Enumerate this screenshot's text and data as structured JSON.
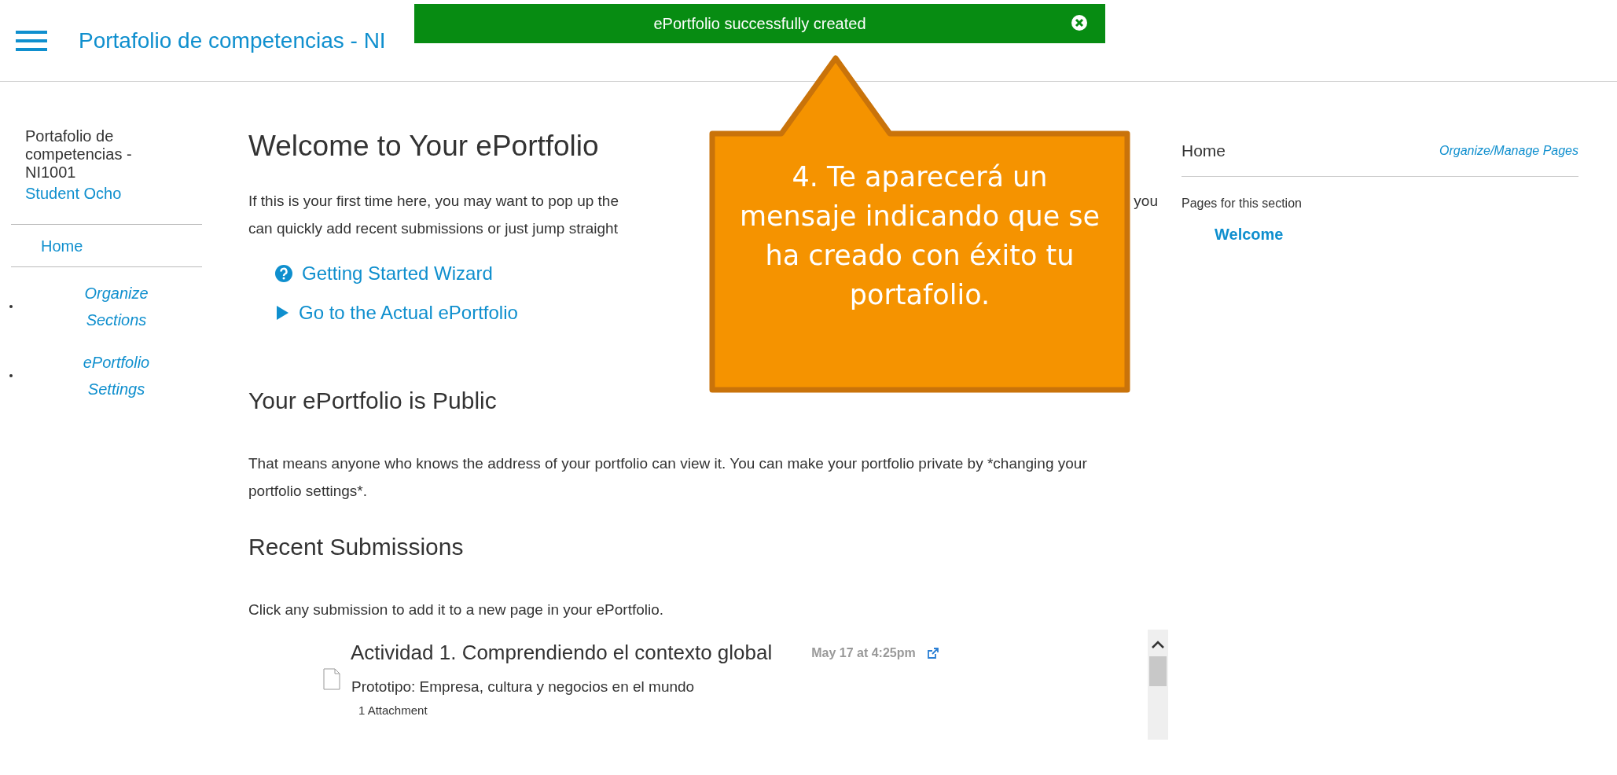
{
  "header": {
    "breadcrumb": "Portafolio de competencias - NI"
  },
  "toast": {
    "message": "ePortfolio successfully created"
  },
  "callout": {
    "text": "4. Te aparecerá un mensaje indicando que se ha creado con éxito tu portafolio."
  },
  "left_sidebar": {
    "portfolio_name": "Portafolio de competencias - NI1001",
    "user": "Student Ocho",
    "home": "Home",
    "items": [
      "Organize Sections",
      "ePortfolio Settings"
    ]
  },
  "main": {
    "title": "Welcome to Your ePortfolio",
    "intro_lines": [
      {
        "left": "If this is your first time here, you may want to pop up the",
        "right": "you"
      },
      {
        "left": "can quickly add recent submissions or just jump straight"
      }
    ],
    "links": [
      {
        "kind": "help",
        "label": "Getting Started Wizard"
      },
      {
        "kind": "go",
        "label": "Go to the Actual ePortfolio"
      }
    ],
    "public_heading": "Your ePortfolio is Public",
    "public_text": "That means anyone who knows the address of your portfolio can view it. You can make your portfolio private by *changing your portfolio settings*.",
    "recent_heading": "Recent Submissions",
    "recent_text": "Click any submission to add it to a new page in your ePortfolio.",
    "submissions": [
      {
        "title": "Actividad 1. Comprendiendo el contexto global",
        "date": "May 17 at 4:25pm",
        "subtitle": "Prototipo: Empresa, cultura y negocios en el mundo",
        "attachments": "1 Attachment"
      }
    ]
  },
  "right_sidebar": {
    "title": "Home",
    "manage": "Organize/Manage Pages",
    "pages_label": "Pages for this section",
    "pages": [
      "Welcome"
    ]
  }
}
